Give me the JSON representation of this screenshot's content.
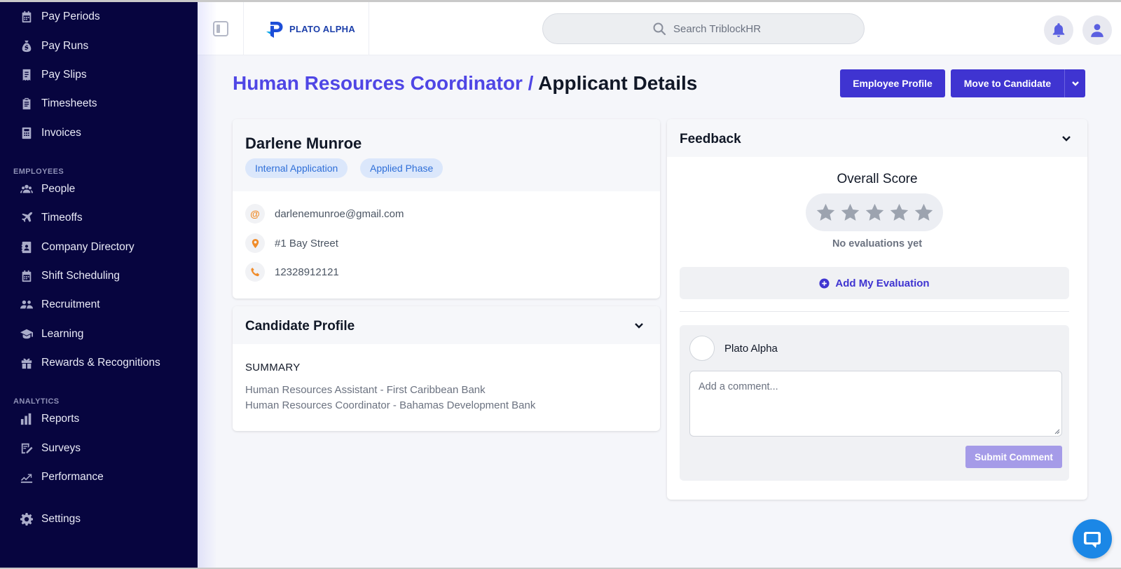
{
  "app": {
    "logo_text": "PLATO ALPHA"
  },
  "sidebar": {
    "items_top": [
      {
        "label": "Pay Periods",
        "icon": "calendar-icon"
      },
      {
        "label": "Pay Runs",
        "icon": "money-bag-icon"
      },
      {
        "label": "Pay Slips",
        "icon": "receipt-icon"
      },
      {
        "label": "Timesheets",
        "icon": "clipboard-icon"
      },
      {
        "label": "Invoices",
        "icon": "calculator-icon"
      }
    ],
    "section_employees": "EMPLOYEES",
    "items_employees": [
      {
        "label": "People",
        "icon": "people-icon"
      },
      {
        "label": "Timeoffs",
        "icon": "plane-icon"
      },
      {
        "label": "Company Directory",
        "icon": "address-book-icon"
      },
      {
        "label": "Shift Scheduling",
        "icon": "calendar-icon"
      },
      {
        "label": "Recruitment",
        "icon": "recruitment-icon"
      },
      {
        "label": "Learning",
        "icon": "graduation-cap-icon"
      },
      {
        "label": "Rewards & Recognitions",
        "icon": "gift-icon"
      }
    ],
    "section_analytics": "ANALYTICS",
    "items_analytics": [
      {
        "label": "Reports",
        "icon": "bar-chart-icon"
      },
      {
        "label": "Surveys",
        "icon": "survey-icon"
      },
      {
        "label": "Performance",
        "icon": "trend-line-icon"
      }
    ],
    "settings_label": "Settings"
  },
  "header": {
    "search_placeholder": "Search TriblockHR"
  },
  "page": {
    "crumb": "Human Resources Coordinator",
    "separator": "/",
    "current": "Applicant Details",
    "employee_profile_button": "Employee Profile",
    "move_button": "Move to Candidate"
  },
  "applicant": {
    "name": "Darlene Munroe",
    "badges": [
      "Internal Application",
      "Applied Phase"
    ],
    "email": "darlenemunroe@gmail.com",
    "address": "#1 Bay Street",
    "phone": "12328912121"
  },
  "candidate_profile": {
    "title": "Candidate Profile",
    "summary_label": "SUMMARY",
    "summary_lines": [
      "Human Resources Assistant - First Caribbean Bank",
      "Human Resources Coordinator - Bahamas Development Bank"
    ]
  },
  "feedback": {
    "title": "Feedback",
    "overall_score_label": "Overall Score",
    "stars_filled": 0,
    "stars_total": 5,
    "no_evaluations": "No evaluations yet",
    "add_evaluation": "Add My Evaluation",
    "comment_author": "Plato Alpha",
    "comment_placeholder": "Add a comment...",
    "submit_label": "Submit Comment"
  },
  "colors": {
    "sidebar_bg": "#07053f",
    "accent": "#3f34d1",
    "badge_bg": "#dbe7fb",
    "badge_text": "#2f6fd8",
    "contact_icon": "#f08c2a",
    "chat_button": "#1b87e6"
  }
}
